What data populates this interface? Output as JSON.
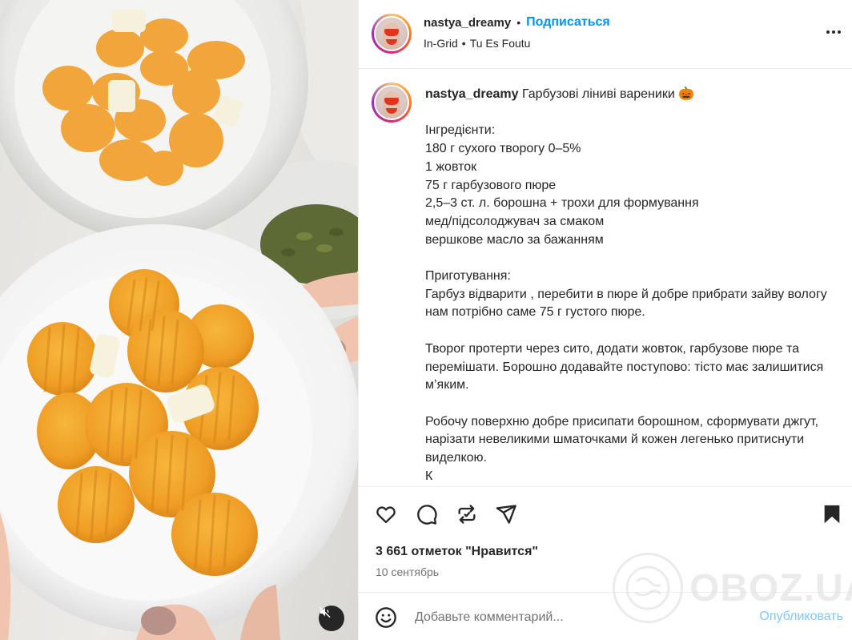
{
  "post": {
    "username": "nastya_dreamy",
    "separator": "•",
    "follow_label": "Подписаться",
    "audio_artist": "In-Grid",
    "audio_sep": "•",
    "audio_track": "Tu Es Foutu"
  },
  "caption": {
    "username": "nastya_dreamy",
    "title": " Гарбузові ліниві вареники 🎃",
    "lines": [
      "",
      "Інгредієнти:",
      "180 г сухого творогу 0–5%",
      "1 жовток",
      "75 г гарбузового пюре",
      "2,5–3 ст. л. борошна + трохи для формування",
      "мед/підсолоджувач за смаком",
      "вершкове масло за бажанням",
      "",
      "Приготування:",
      "Гарбуз відварити , перебити в пюре й добре прибрати зайву вологу нам потрібно саме 75 г густого пюре.",
      "",
      "Творог протерти через сито, додати жовток, гарбузове пюре та перемішати. Борошно додавайте поступово: тісто має залишитися м’яким.",
      "",
      "Робочу поверхню добре присипати борошном, сформувати джгут, нарізати невеликими шматочками й кожен легенько притиснути виделкою."
    ]
  },
  "engagement": {
    "likes": "3 661 отметок \"Нравится\"",
    "date": "10 сентябрь"
  },
  "watermark": "OBOZ.UA",
  "comment": {
    "placeholder": "Добавьте комментарий...",
    "publish_label": "Опубликовать"
  },
  "icons": {
    "like": "heart-icon",
    "comment": "comment-icon",
    "repost": "repost-icon",
    "share": "send-icon",
    "save": "bookmark-icon",
    "emoji": "emoji-icon",
    "more": "more-icon",
    "mute": "muted-speaker-icon"
  },
  "colors": {
    "link": "#0095f6",
    "publish_disabled": "#7ec8f8",
    "text": "#262626",
    "muted": "#737373"
  }
}
